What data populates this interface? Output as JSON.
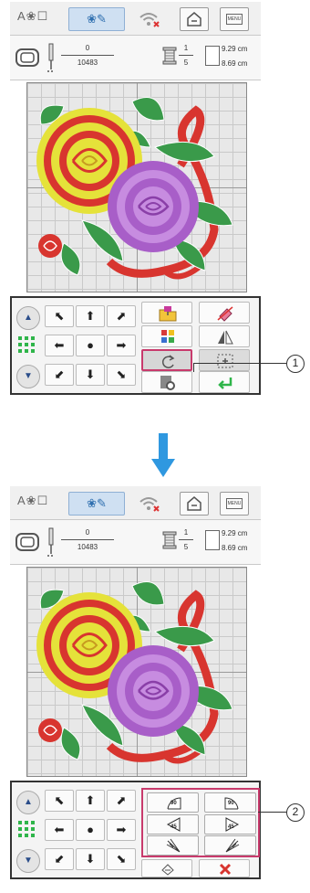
{
  "topbar": {
    "mode_text_label": "A",
    "wifi_status": "disconnected"
  },
  "info": {
    "stitch_current": "0",
    "stitch_total": "10483",
    "color_current": "1",
    "color_total": "5",
    "width": "9.29 cm",
    "height": "8.69 cm"
  },
  "menu_label": "MENU",
  "callouts": {
    "one": "1",
    "two": "2"
  },
  "rotate_labels": {
    "left90": "90",
    "right90": "90",
    "left45": "45",
    "right45": "45"
  },
  "colors": {
    "accent_blue": "#2f98e0",
    "highlight_pink": "#c83a6c",
    "rose_red": "#d8352f",
    "rose_yellow": "#e5e23a",
    "rose_purple": "#a85ec8",
    "leaf_green": "#3a9a4a"
  }
}
